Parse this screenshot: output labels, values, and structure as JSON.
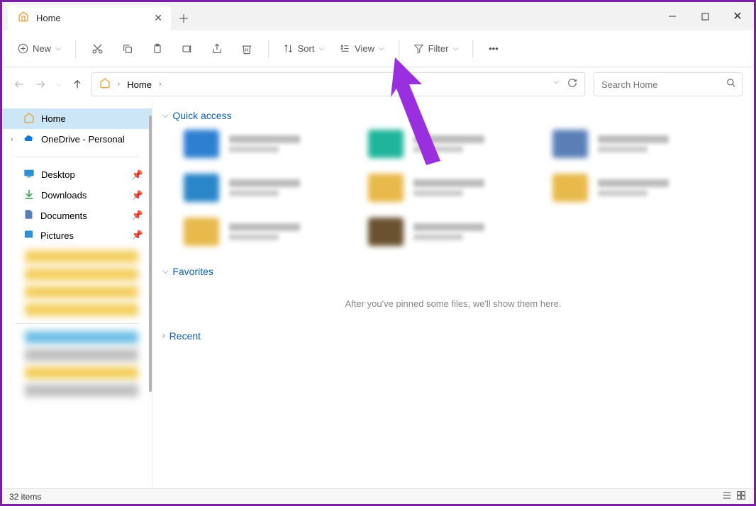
{
  "tab": {
    "title": "Home"
  },
  "toolbar": {
    "new": "New",
    "sort": "Sort",
    "view": "View",
    "filter": "Filter"
  },
  "breadcrumb": {
    "location": "Home"
  },
  "search": {
    "placeholder": "Search Home"
  },
  "sidebar": {
    "home": "Home",
    "onedrive": "OneDrive - Personal",
    "desktop": "Desktop",
    "downloads": "Downloads",
    "documents": "Documents",
    "pictures": "Pictures"
  },
  "sections": {
    "quick_access": "Quick access",
    "favorites": "Favorites",
    "recent": "Recent",
    "favorites_empty": "After you've pinned some files, we'll show them here."
  },
  "quick_items_colors": [
    "#2e7fd1",
    "#1fb59a",
    "#5a7fb7",
    "#2a86c8",
    "#e8b94b",
    "#e8b94b",
    "#e8b94b",
    "#6a5230"
  ],
  "status": {
    "items": "32 items"
  }
}
